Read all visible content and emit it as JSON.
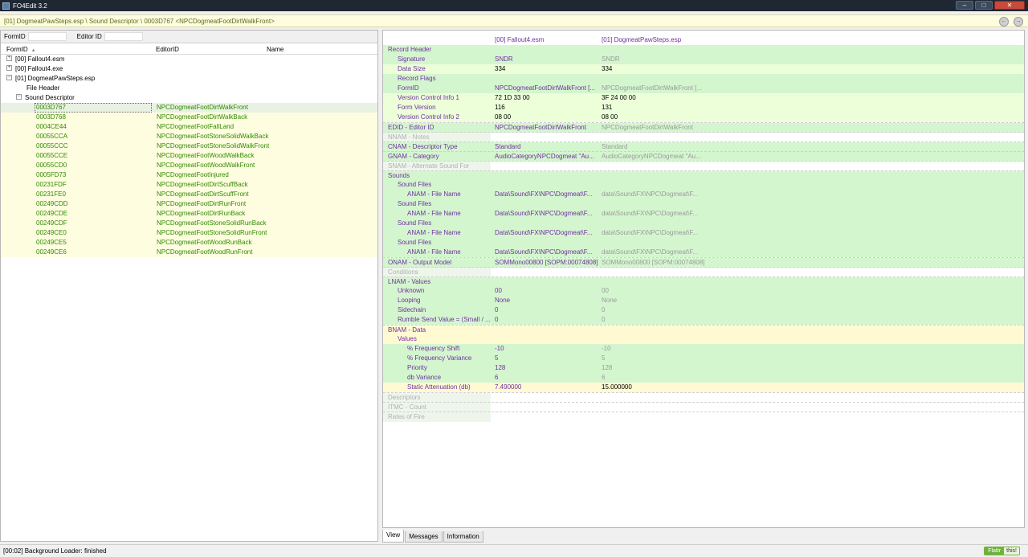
{
  "window": {
    "title": "FO4Edit 3.2",
    "minimize": "–",
    "maximize": "□",
    "close": "✕"
  },
  "path": {
    "text": "[01] DogmeatPawSteps.esp \\ Sound Descriptor \\ 0003D767 <NPCDogmeatFootDirtWalkFront>",
    "back_icon": "←",
    "forward_icon": "→"
  },
  "filter": {
    "formid_label": "FormID",
    "editorid_label": "Editor ID"
  },
  "tree": {
    "headers": {
      "formid": "FormID",
      "editorid": "EditorID",
      "name": "Name"
    },
    "files": [
      {
        "expander": "+",
        "label": "[00] Fallout4.esm"
      },
      {
        "expander": "+",
        "label": "[00] Fallout4.exe"
      },
      {
        "expander": "−",
        "label": "[01] DogmeatPawSteps.esp"
      }
    ],
    "file_header": "File Header",
    "group": {
      "expander": "−",
      "label": "Sound Descriptor"
    },
    "records": [
      {
        "formid": "0003D767",
        "editorid": "NPCDogmeatFootDirtWalkFront"
      },
      {
        "formid": "0003D768",
        "editorid": "NPCDogmeatFootDirtWalkBack"
      },
      {
        "formid": "0004CE44",
        "editorid": "NPCDogmeatFootFallLand"
      },
      {
        "formid": "00055CCA",
        "editorid": "NPCDogmeatFootStoneSolidWalkBack"
      },
      {
        "formid": "00055CCC",
        "editorid": "NPCDogmeatFootStoneSolidWalkFront"
      },
      {
        "formid": "00055CCE",
        "editorid": "NPCDogmeatFootWoodWalkBack"
      },
      {
        "formid": "00055CD0",
        "editorid": "NPCDogmeatFootWoodWalkFront"
      },
      {
        "formid": "0005FD73",
        "editorid": "NPCDogmeatFootInjured"
      },
      {
        "formid": "00231FDF",
        "editorid": "NPCDogmeatFootDirtScuffBack"
      },
      {
        "formid": "00231FE0",
        "editorid": "NPCDogmeatFootDirtScuffFront"
      },
      {
        "formid": "00249CDD",
        "editorid": "NPCDogmeatFootDirtRunFront"
      },
      {
        "formid": "00249CDE",
        "editorid": "NPCDogmeatFootDirtRunBack"
      },
      {
        "formid": "00249CDF",
        "editorid": "NPCDogmeatFootStoneSolidRunBack"
      },
      {
        "formid": "00249CE0",
        "editorid": "NPCDogmeatFootStoneSolidRunFront"
      },
      {
        "formid": "00249CE5",
        "editorid": "NPCDogmeatFootWoodRunBack"
      },
      {
        "formid": "00249CE6",
        "editorid": "NPCDogmeatFootWoodRunFront"
      }
    ]
  },
  "record_view": {
    "col1": "[00] Fallout4.esm",
    "col2": "[01] DogmeatPawSteps.esp",
    "rows": [
      {
        "label": "Record Header",
        "indent": 0,
        "v1": "",
        "v2": "",
        "style": "g",
        "v2diff": false
      },
      {
        "label": "Signature",
        "indent": 1,
        "v1": "SNDR",
        "v2": "SNDR",
        "style": "g",
        "v2diff": false
      },
      {
        "label": "Data Size",
        "indent": 1,
        "v1": "334",
        "v2": "334",
        "style": "gy",
        "v2diff": true
      },
      {
        "label": "Record Flags",
        "indent": 1,
        "v1": "",
        "v2": "",
        "style": "g",
        "v2diff": false
      },
      {
        "label": "FormID",
        "indent": 1,
        "v1": "NPCDogmeatFootDirtWalkFront [...",
        "v2": "NPCDogmeatFootDirtWalkFront [...",
        "style": "g",
        "v2diff": false
      },
      {
        "label": "Version Control Info 1",
        "indent": 1,
        "v1": "72 1D 33 00",
        "v2": "3F 24 00 00",
        "style": "gy",
        "v2diff": true
      },
      {
        "label": "Form Version",
        "indent": 1,
        "v1": "116",
        "v2": "131",
        "style": "gy",
        "v2diff": true
      },
      {
        "label": "Version Control Info 2",
        "indent": 1,
        "v1": "08 00",
        "v2": "08 00",
        "style": "gy",
        "v2diff": true
      },
      {
        "label": "EDID - Editor ID",
        "indent": 0,
        "v1": "NPCDogmeatFootDirtWalkFront",
        "v2": "NPCDogmeatFootDirtWalkFront",
        "style": "g",
        "v2diff": false
      },
      {
        "label": "NNAM - Notes",
        "indent": 0,
        "v1": "",
        "v2": "",
        "style": "w",
        "dim": true,
        "v2diff": false
      },
      {
        "label": "CNAM - Descriptor Type",
        "indent": 0,
        "v1": "Standard",
        "v2": "Standard",
        "style": "g",
        "v2diff": false
      },
      {
        "label": "GNAM - Category",
        "indent": 0,
        "v1": "AudioCategoryNPCDogmeat \"Au...",
        "v2": "AudioCategoryNPCDogmeat \"Au...",
        "style": "g",
        "v2diff": false
      },
      {
        "label": "SNAM - Alternate Sound For",
        "indent": 0,
        "v1": "",
        "v2": "",
        "style": "w",
        "dim": true,
        "v2diff": false
      },
      {
        "label": "Sounds",
        "indent": 0,
        "v1": "",
        "v2": "",
        "style": "g",
        "v2diff": false
      },
      {
        "label": "Sound Files",
        "indent": 1,
        "v1": "",
        "v2": "",
        "style": "g",
        "v2diff": false
      },
      {
        "label": "ANAM - File Name",
        "indent": 2,
        "v1": "Data\\Sound\\FX\\NPC\\Dogmeat\\F...",
        "v2": "data\\Sound\\FX\\NPC\\Dogmeat\\F...",
        "style": "g",
        "v2diff": false
      },
      {
        "label": "Sound Files",
        "indent": 1,
        "v1": "",
        "v2": "",
        "style": "g",
        "v2diff": false
      },
      {
        "label": "ANAM - File Name",
        "indent": 2,
        "v1": "Data\\Sound\\FX\\NPC\\Dogmeat\\F...",
        "v2": "data\\Sound\\FX\\NPC\\Dogmeat\\F...",
        "style": "g",
        "v2diff": false
      },
      {
        "label": "Sound Files",
        "indent": 1,
        "v1": "",
        "v2": "",
        "style": "g",
        "v2diff": false
      },
      {
        "label": "ANAM - File Name",
        "indent": 2,
        "v1": "Data\\Sound\\FX\\NPC\\Dogmeat\\F...",
        "v2": "data\\Sound\\FX\\NPC\\Dogmeat\\F...",
        "style": "g",
        "v2diff": false
      },
      {
        "label": "Sound Files",
        "indent": 1,
        "v1": "",
        "v2": "",
        "style": "g",
        "v2diff": false
      },
      {
        "label": "ANAM - File Name",
        "indent": 2,
        "v1": "Data\\Sound\\FX\\NPC\\Dogmeat\\F...",
        "v2": "data\\Sound\\FX\\NPC\\Dogmeat\\F...",
        "style": "g",
        "v2diff": false
      },
      {
        "label": "ONAM - Output Model",
        "indent": 0,
        "v1": "SOMMono00800 [SOPM:00074808]",
        "v2": "SOMMono00800 [SOPM:00074808]",
        "style": "g",
        "v2diff": false
      },
      {
        "label": "Conditions",
        "indent": 0,
        "v1": "",
        "v2": "",
        "style": "w",
        "dim": true,
        "v2diff": false
      },
      {
        "label": "LNAM - Values",
        "indent": 0,
        "v1": "",
        "v2": "",
        "style": "g",
        "v2diff": false
      },
      {
        "label": "Unknown",
        "indent": 1,
        "v1": "00",
        "v2": "00",
        "style": "g",
        "v2diff": false
      },
      {
        "label": "Looping",
        "indent": 1,
        "v1": "None",
        "v2": "None",
        "style": "g",
        "v2diff": false
      },
      {
        "label": "Sidechain",
        "indent": 1,
        "v1": "0",
        "v2": "0",
        "style": "g",
        "v2diff": false
      },
      {
        "label": "Rumble Send Value = (Small / ...",
        "indent": 1,
        "v1": "0",
        "v2": "0",
        "style": "g",
        "v2diff": false
      },
      {
        "label": "BNAM - Data",
        "indent": 0,
        "v1": "",
        "v2": "",
        "style": "yl",
        "v2diff": false
      },
      {
        "label": "Values",
        "indent": 1,
        "v1": "",
        "v2": "",
        "style": "yl",
        "v2diff": false
      },
      {
        "label": "% Frequency Shift",
        "indent": 2,
        "v1": "-10",
        "v2": "-10",
        "style": "g",
        "v2diff": false
      },
      {
        "label": "% Frequency Variance",
        "indent": 2,
        "v1": "5",
        "v2": "5",
        "style": "g",
        "v2diff": false
      },
      {
        "label": "Priority",
        "indent": 2,
        "v1": "128",
        "v2": "128",
        "style": "g",
        "v2diff": false
      },
      {
        "label": "db Variance",
        "indent": 2,
        "v1": "6",
        "v2": "6",
        "style": "g",
        "v2diff": false
      },
      {
        "label": "Static Attenuation (db)",
        "indent": 2,
        "v1": "7.490000",
        "v2": "15.000000",
        "style": "yl",
        "v2diff": true
      },
      {
        "label": "Descriptors",
        "indent": 0,
        "v1": "",
        "v2": "",
        "style": "w",
        "dim": true,
        "v2diff": false
      },
      {
        "label": "ITMC - Count",
        "indent": 0,
        "v1": "",
        "v2": "",
        "style": "w",
        "dim": true,
        "v2diff": false
      },
      {
        "label": "Rates of Fire",
        "indent": 0,
        "v1": "",
        "v2": "",
        "style": "w",
        "dim": true,
        "v2diff": false
      }
    ]
  },
  "tabs": [
    "View",
    "Messages",
    "Information"
  ],
  "status": {
    "text": "[00:02] Background Loader: finished",
    "flattr": "Flattr",
    "flattr_this": "this!"
  }
}
